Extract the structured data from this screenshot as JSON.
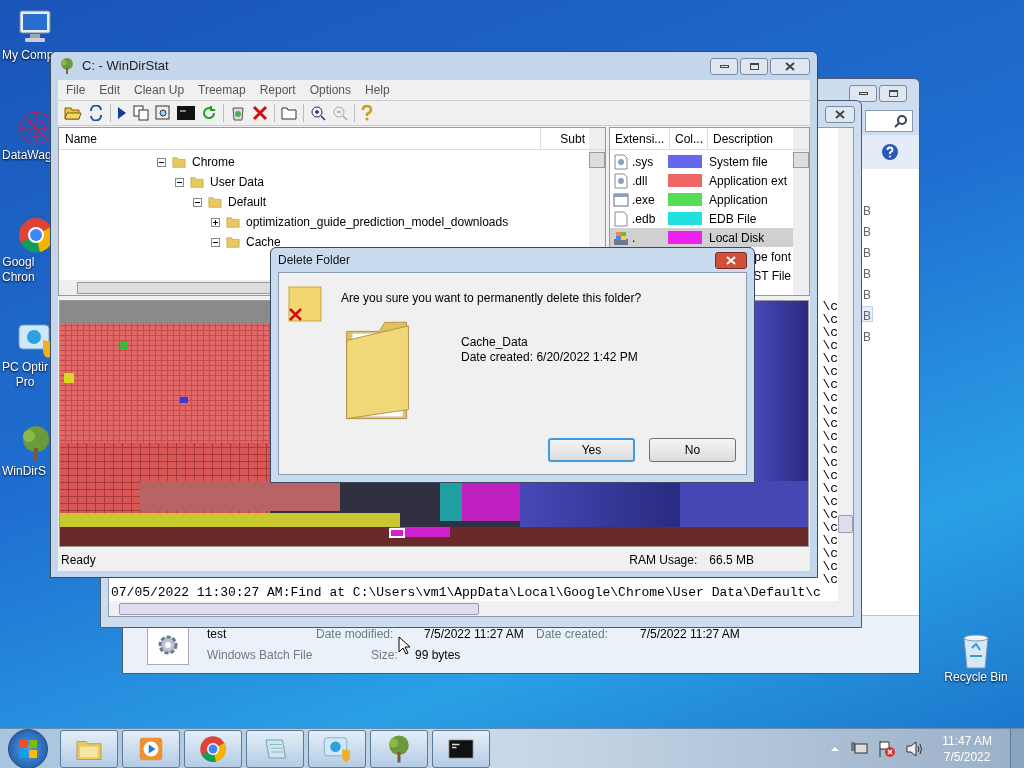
{
  "desktop": {
    "icons": [
      {
        "kind": "computer",
        "lines": [
          "My Comp"
        ]
      },
      {
        "kind": "network",
        "lines": [
          "DataWag"
        ]
      },
      {
        "kind": "chrome",
        "lines": [
          "Googl",
          "Chron"
        ]
      },
      {
        "kind": "optimizer",
        "lines": [
          "PC Optir",
          "Pro"
        ]
      },
      {
        "kind": "tree",
        "lines": [
          "WinDirS"
        ]
      },
      {
        "kind": "recycle",
        "lines": [
          "Recycle Bin"
        ]
      }
    ]
  },
  "explorer": {
    "size_column": [
      {
        "text": "B",
        "selected": false
      },
      {
        "text": "B",
        "selected": false
      },
      {
        "text": "B",
        "selected": false
      },
      {
        "text": "B",
        "selected": false
      },
      {
        "text": "B",
        "selected": false
      },
      {
        "text": "B",
        "selected": true
      },
      {
        "text": "B",
        "selected": false
      }
    ],
    "details": {
      "name": "test",
      "modified_label": "Date modified:",
      "modified": "7/5/2022 11:27 AM",
      "created_label": "Date created:",
      "created": "7/5/2022 11:27 AM",
      "type": "Windows Batch File",
      "size_label": "Size:",
      "size": "99 bytes"
    }
  },
  "log_window": {
    "line_tails": [
      "\\c",
      "\\c",
      "\\c",
      "\\c",
      "\\c",
      "\\c",
      "\\c",
      "\\c",
      "\\c",
      "\\c",
      "\\c",
      "\\c",
      "\\c",
      "\\c",
      "\\c",
      "\\c",
      "\\c",
      "\\c",
      "\\c",
      "\\c",
      "\\c",
      "\\c"
    ],
    "last_line": "07/05/2022 11:30:27 AM:Find at C:\\Users\\vm1\\AppData\\Local\\Google\\Chrome\\User Data\\Default\\c"
  },
  "windirstat": {
    "title": "C: - WinDirStat",
    "menu": [
      "File",
      "Edit",
      "Clean Up",
      "Treemap",
      "Report",
      "Options",
      "Help"
    ],
    "tree": {
      "columns": [
        "Name",
        "Subt"
      ],
      "items": [
        {
          "name": "Chrome",
          "expanded": true,
          "children": [
            {
              "name": "User Data",
              "expanded": true,
              "children": [
                {
                  "name": "Default",
                  "expanded": true,
                  "children": [
                    {
                      "name": "optimization_guide_prediction_model_downloads",
                      "expanded": false
                    },
                    {
                      "name": "Cache",
                      "expanded": true
                    }
                  ]
                }
              ]
            }
          ]
        }
      ]
    },
    "extensions": {
      "columns": [
        "Extensi...",
        "Col...",
        "Description"
      ],
      "rows": [
        {
          "kind": "system",
          "ext": ".sys",
          "color": "#6666ee",
          "description": "System file",
          "selected": false
        },
        {
          "kind": "system",
          "ext": ".dll",
          "color": "#ee6666",
          "description": "Application ext",
          "selected": false
        },
        {
          "kind": "program",
          "ext": ".exe",
          "color": "#55dd55",
          "description": "Application",
          "selected": false
        },
        {
          "kind": "document",
          "ext": ".edb",
          "color": "#22e0e0",
          "description": "EDB File",
          "selected": false
        },
        {
          "kind": "drive",
          "ext": ".",
          "color": "#ee22ee",
          "description": "Local Disk",
          "selected": true
        },
        {
          "kind": "partial",
          "description": "pe font"
        },
        {
          "kind": "partial",
          "description": "ST File"
        }
      ]
    },
    "status": {
      "text": "Ready",
      "ram_label": "RAM Usage:",
      "ram_value": "66.5 MB"
    }
  },
  "dialog": {
    "title": "Delete Folder",
    "question": "Are you sure you want to permanently delete this folder?",
    "item_name": "Cache_Data",
    "item_detail": "Date created: 6/20/2022 1:42 PM",
    "buttons": [
      {
        "label": "Yes",
        "selected": true
      },
      {
        "label": "No",
        "selected": false
      }
    ]
  },
  "taskbar": {
    "apps": [
      {
        "kind": "explorer"
      },
      {
        "kind": "media"
      },
      {
        "kind": "chrome"
      },
      {
        "kind": "notepad"
      },
      {
        "kind": "optimizer"
      },
      {
        "kind": "tree"
      },
      {
        "kind": "console"
      }
    ],
    "clock": {
      "time": "11:47 AM",
      "date": "7/5/2022"
    }
  }
}
